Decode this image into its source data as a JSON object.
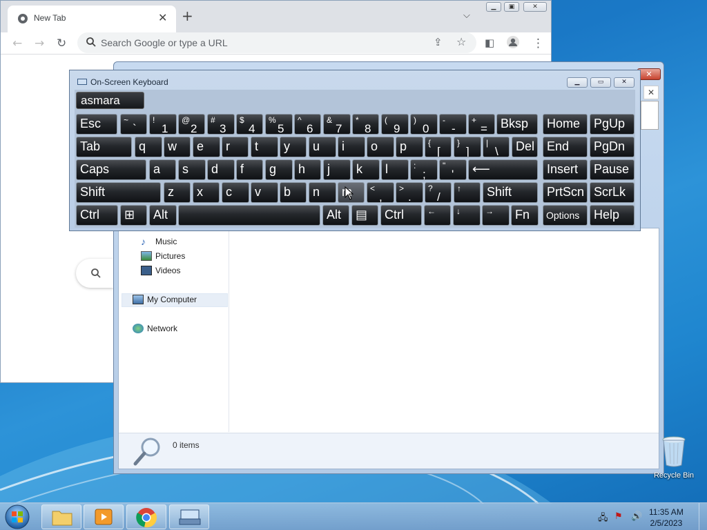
{
  "chrome": {
    "tab_title": "New Tab",
    "omnibox_placeholder": "Search Google or type a URL"
  },
  "explorer": {
    "nav_items": [
      "Music",
      "Pictures",
      "Videos",
      "My Computer",
      "Network"
    ],
    "status": "0 items"
  },
  "osk": {
    "title": "On-Screen Keyboard",
    "prediction": "asmara",
    "row1": [
      {
        "m": "Esc"
      },
      {
        "sh": "~",
        "lo": "`"
      },
      {
        "sh": "!",
        "lo": "1"
      },
      {
        "sh": "@",
        "lo": "2"
      },
      {
        "sh": "#",
        "lo": "3"
      },
      {
        "sh": "$",
        "lo": "4"
      },
      {
        "sh": "%",
        "lo": "5"
      },
      {
        "sh": "^",
        "lo": "6"
      },
      {
        "sh": "&",
        "lo": "7"
      },
      {
        "sh": "*",
        "lo": "8"
      },
      {
        "sh": "(",
        "lo": "9"
      },
      {
        "sh": ")",
        "lo": "0"
      },
      {
        "sh": "-",
        "lo": "-"
      },
      {
        "sh": "+",
        "lo": "="
      },
      {
        "m": "Bksp"
      },
      {
        "m": "Home"
      },
      {
        "m": "PgUp"
      }
    ],
    "row2": [
      {
        "m": "Tab"
      },
      {
        "m": "q"
      },
      {
        "m": "w"
      },
      {
        "m": "e"
      },
      {
        "m": "r"
      },
      {
        "m": "t"
      },
      {
        "m": "y"
      },
      {
        "m": "u"
      },
      {
        "m": "i"
      },
      {
        "m": "o"
      },
      {
        "m": "p"
      },
      {
        "sh": "{",
        "lo": "["
      },
      {
        "sh": "}",
        "lo": "]"
      },
      {
        "sh": "|",
        "lo": "\\"
      },
      {
        "m": "Del"
      },
      {
        "m": "End"
      },
      {
        "m": "PgDn"
      }
    ],
    "row3": [
      {
        "m": "Caps"
      },
      {
        "m": "a"
      },
      {
        "m": "s"
      },
      {
        "m": "d"
      },
      {
        "m": "f"
      },
      {
        "m": "g"
      },
      {
        "m": "h"
      },
      {
        "m": "j"
      },
      {
        "m": "k"
      },
      {
        "m": "l"
      },
      {
        "sh": ":",
        "lo": ";"
      },
      {
        "sh": "\"",
        "lo": "'"
      },
      {
        "m": "⟵"
      },
      {
        "m": "Insert"
      },
      {
        "m": "Pause"
      }
    ],
    "row4": [
      {
        "m": "Shift"
      },
      {
        "m": "z"
      },
      {
        "m": "x"
      },
      {
        "m": "c"
      },
      {
        "m": "v"
      },
      {
        "m": "b"
      },
      {
        "m": "n"
      },
      {
        "m": "m"
      },
      {
        "sh": "<",
        "lo": ","
      },
      {
        "sh": ">",
        "lo": "."
      },
      {
        "sh": "?",
        "lo": "/"
      },
      {
        "sh": "↑",
        "lo": ""
      },
      {
        "m": "Shift"
      },
      {
        "m": "PrtScn"
      },
      {
        "m": "ScrLk"
      }
    ],
    "row5": [
      {
        "m": "Ctrl"
      },
      {
        "m": "⊞"
      },
      {
        "m": "Alt"
      },
      {
        "m": ""
      },
      {
        "m": "Alt"
      },
      {
        "m": "▤"
      },
      {
        "m": "Ctrl"
      },
      {
        "sh": "←",
        "lo": ""
      },
      {
        "sh": "↓",
        "lo": ""
      },
      {
        "sh": "→",
        "lo": ""
      },
      {
        "m": "Fn"
      },
      {
        "sm": "Options"
      },
      {
        "m": "Help"
      }
    ]
  },
  "desktop": {
    "recycle_bin": "Recycle Bin"
  },
  "taskbar": {
    "time": "11:35 AM",
    "date": "2/5/2023"
  }
}
